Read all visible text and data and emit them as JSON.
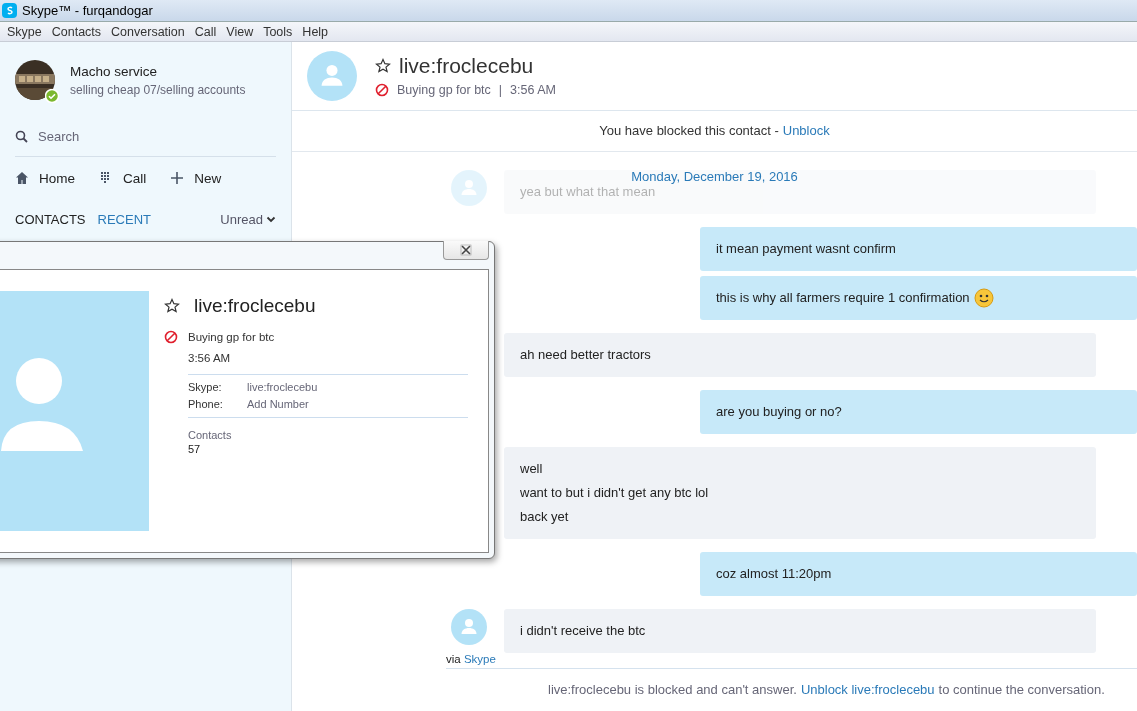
{
  "window": {
    "title": "Skype™ - furqandogar"
  },
  "menu": [
    "Skype",
    "Contacts",
    "Conversation",
    "Call",
    "View",
    "Tools",
    "Help"
  ],
  "sidebar": {
    "profile": {
      "name": "Macho service",
      "mood": "selling cheap 07/selling accounts",
      "online": true
    },
    "search": {
      "placeholder": "Search"
    },
    "actions": [
      {
        "kind": "home",
        "label": "Home"
      },
      {
        "kind": "dialpad",
        "label": "Call"
      },
      {
        "kind": "new",
        "label": "New"
      }
    ],
    "tabs": [
      {
        "label": "CONTACTS",
        "selected": false
      },
      {
        "label": "RECENT",
        "selected": true
      }
    ],
    "filter": "Unread"
  },
  "conversation": {
    "contact": "live:froclecebu",
    "favorite": false,
    "blocked": true,
    "mood": "Buying gp for btc",
    "separator": "|",
    "time": "3:56 AM",
    "notice": {
      "text": "You have blocked this contact -",
      "link": "Unblock"
    },
    "date": "Monday, December 19, 2016",
    "messages": [
      {
        "kind": "incoming",
        "avatar": true,
        "faded": true,
        "emoji": false,
        "lines": [
          "yea but what that mean"
        ]
      },
      {
        "kind": "outgoing",
        "avatar": false,
        "faded": false,
        "emoji": false,
        "lines": [
          "it mean payment wasnt confirm"
        ]
      },
      {
        "kind": "outgoing",
        "avatar": false,
        "faded": false,
        "emoji": true,
        "lines": [
          "this is why all farmers require 1 confirmation"
        ]
      },
      {
        "kind": "incoming",
        "avatar": false,
        "faded": false,
        "emoji": false,
        "lines": [
          "ah need better tractors"
        ]
      },
      {
        "kind": "outgoing",
        "avatar": false,
        "faded": false,
        "emoji": false,
        "lines": [
          "are you buying or no?"
        ]
      },
      {
        "kind": "incoming",
        "avatar": false,
        "faded": false,
        "emoji": false,
        "lines": [
          "well",
          "want to but i didn't get any btc lol",
          "back yet"
        ]
      },
      {
        "kind": "outgoing",
        "avatar": false,
        "faded": false,
        "emoji": false,
        "lines": [
          "coz almost 11:20pm"
        ]
      },
      {
        "kind": "incoming",
        "avatar": true,
        "faded": false,
        "emoji": false,
        "lines": [
          "i didn't receive the btc"
        ]
      }
    ],
    "via": {
      "text": "via",
      "link": "Skype"
    },
    "footer": {
      "before": "live:froclecebu is blocked and can't answer.",
      "link": "Unblock live:froclecebu",
      "after": "to continue the conversation."
    }
  },
  "profile_card": {
    "name": "live:froclecebu",
    "favorite": false,
    "blocked": true,
    "mood": "Buying gp for btc",
    "time": "3:56 AM",
    "fields": [
      {
        "label": "Skype:",
        "value": "live:froclecebu"
      },
      {
        "label": "Phone:",
        "value": "Add Number"
      }
    ],
    "contacts_label": "Contacts",
    "contacts_count": "57"
  }
}
